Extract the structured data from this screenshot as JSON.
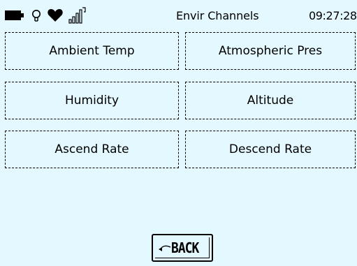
{
  "status_bar": {
    "icons": [
      "battery-icon",
      "light-bulb-icon",
      "heart-icon",
      "signal-strength-icon"
    ],
    "title": "Envir Channels",
    "time": "09:27:28"
  },
  "channels": [
    {
      "label": "Ambient Temp"
    },
    {
      "label": "Atmospheric Pres"
    },
    {
      "label": "Humidity"
    },
    {
      "label": "Altitude"
    },
    {
      "label": "Ascend Rate"
    },
    {
      "label": "Descend Rate"
    }
  ],
  "back_button": {
    "icon": "back-arrow-icon",
    "label": "BACK"
  },
  "colors": {
    "background": "#e3f8ff",
    "foreground": "#000000"
  }
}
